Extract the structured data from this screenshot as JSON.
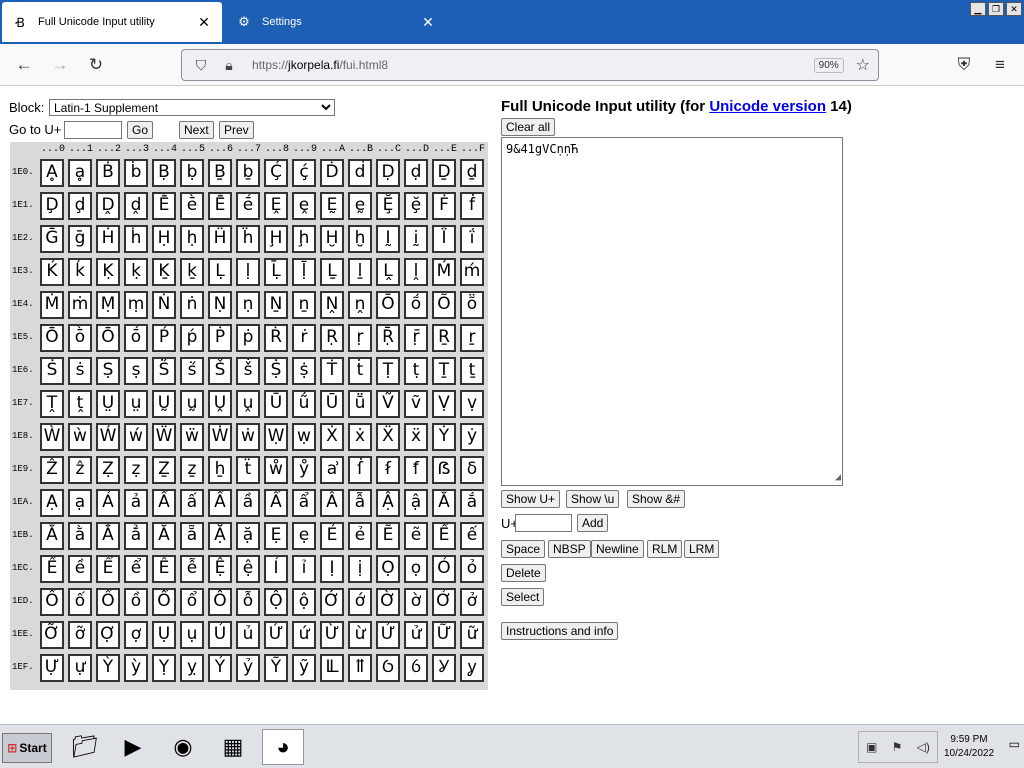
{
  "browser": {
    "tabs": [
      {
        "title": "Full Unicode Input utility",
        "icon": "unicode-favicon"
      },
      {
        "title": "Settings",
        "icon": "gear-icon"
      }
    ],
    "url_prefix": "https://",
    "url_host": "jkorpela.fi",
    "url_path": "/fui.html8",
    "zoom": "90%"
  },
  "page": {
    "block_label": "Block:",
    "block_selected": "Latin-1 Supplement",
    "goto_label": "Go to U+",
    "goto_value": "",
    "go_button": "Go",
    "next_button": "Next",
    "prev_button": "Prev",
    "title_prefix": "Full Unicode Input utility (for ",
    "title_link": "Unicode version",
    "title_suffix": " 14)",
    "clear_all": "Clear all",
    "textarea_value": "9&41gVϹṇṇЋ",
    "show_u_plus": "Show U+",
    "show_backslash_u": "Show \\u",
    "show_amp_hash": "Show &#",
    "uplus_label": "U+",
    "uplus_value": "",
    "add_button": "Add",
    "space_button": "Space",
    "nbsp_button": "NBSP",
    "newline_button": "Newline",
    "rlm_button": "RLM",
    "lrm_button": "LRM",
    "delete_button": "Delete",
    "select_button": "Select",
    "instructions_button": "Instructions and info"
  },
  "grid": {
    "column_headers": [
      "...0",
      "...1",
      "...2",
      "...3",
      "...4",
      "...5",
      "...6",
      "...7",
      "...8",
      "...9",
      "...A",
      "...B",
      "...C",
      "...D",
      "...E",
      "...F"
    ],
    "rows": [
      {
        "label": "1E0.",
        "chars": [
          "Ḁ",
          "ḁ",
          "Ḃ",
          "ḃ",
          "Ḅ",
          "ḅ",
          "Ḇ",
          "ḇ",
          "Ḉ",
          "ḉ",
          "Ḋ",
          "ḋ",
          "Ḍ",
          "ḍ",
          "Ḏ",
          "ḏ"
        ]
      },
      {
        "label": "1E1.",
        "chars": [
          "Ḑ",
          "ḑ",
          "Ḓ",
          "ḓ",
          "Ḕ",
          "ḕ",
          "Ḗ",
          "ḗ",
          "Ḙ",
          "ḙ",
          "Ḛ",
          "ḛ",
          "Ḝ",
          "ḝ",
          "Ḟ",
          "ḟ"
        ]
      },
      {
        "label": "1E2.",
        "chars": [
          "Ḡ",
          "ḡ",
          "Ḣ",
          "ḣ",
          "Ḥ",
          "ḥ",
          "Ḧ",
          "ḧ",
          "Ḩ",
          "ḩ",
          "Ḫ",
          "ḫ",
          "Ḭ",
          "ḭ",
          "Ḯ",
          "ḯ"
        ]
      },
      {
        "label": "1E3.",
        "chars": [
          "Ḱ",
          "ḱ",
          "Ḳ",
          "ḳ",
          "Ḵ",
          "ḵ",
          "Ḷ",
          "ḷ",
          "Ḹ",
          "ḹ",
          "Ḻ",
          "ḻ",
          "Ḽ",
          "ḽ",
          "Ḿ",
          "ḿ"
        ]
      },
      {
        "label": "1E4.",
        "chars": [
          "Ṁ",
          "ṁ",
          "Ṃ",
          "ṃ",
          "Ṅ",
          "ṅ",
          "Ṇ",
          "ṇ",
          "Ṉ",
          "ṉ",
          "Ṋ",
          "ṋ",
          "Ṍ",
          "ṍ",
          "Ṏ",
          "ṏ"
        ]
      },
      {
        "label": "1E5.",
        "chars": [
          "Ṑ",
          "ṑ",
          "Ṓ",
          "ṓ",
          "Ṕ",
          "ṕ",
          "Ṗ",
          "ṗ",
          "Ṙ",
          "ṙ",
          "Ṛ",
          "ṛ",
          "Ṝ",
          "ṝ",
          "Ṟ",
          "ṟ"
        ]
      },
      {
        "label": "1E6.",
        "chars": [
          "Ṡ",
          "ṡ",
          "Ṣ",
          "ṣ",
          "Ṥ",
          "ṥ",
          "Ṧ",
          "ṧ",
          "Ṩ",
          "ṩ",
          "Ṫ",
          "ṫ",
          "Ṭ",
          "ṭ",
          "Ṯ",
          "ṯ"
        ]
      },
      {
        "label": "1E7.",
        "chars": [
          "Ṱ",
          "ṱ",
          "Ṳ",
          "ṳ",
          "Ṵ",
          "ṵ",
          "Ṷ",
          "ṷ",
          "Ṹ",
          "ṹ",
          "Ṻ",
          "ṻ",
          "Ṽ",
          "ṽ",
          "Ṿ",
          "ṿ"
        ]
      },
      {
        "label": "1E8.",
        "chars": [
          "Ẁ",
          "ẁ",
          "Ẃ",
          "ẃ",
          "Ẅ",
          "ẅ",
          "Ẇ",
          "ẇ",
          "Ẉ",
          "ẉ",
          "Ẋ",
          "ẋ",
          "Ẍ",
          "ẍ",
          "Ẏ",
          "ẏ"
        ]
      },
      {
        "label": "1E9.",
        "chars": [
          "Ẑ",
          "ẑ",
          "Ẓ",
          "ẓ",
          "Ẕ",
          "ẕ",
          "ẖ",
          "ẗ",
          "ẘ",
          "ẙ",
          "ẚ",
          "ẛ",
          "ẜ",
          "ẝ",
          "ẞ",
          "ẟ"
        ]
      },
      {
        "label": "1EA.",
        "chars": [
          "Ạ",
          "ạ",
          "Ả",
          "ả",
          "Ấ",
          "ấ",
          "Ầ",
          "ầ",
          "Ẩ",
          "ẩ",
          "Ẫ",
          "ẫ",
          "Ậ",
          "ậ",
          "Ắ",
          "ắ"
        ]
      },
      {
        "label": "1EB.",
        "chars": [
          "Ằ",
          "ằ",
          "Ẳ",
          "ẳ",
          "Ẵ",
          "ẵ",
          "Ặ",
          "ặ",
          "Ẹ",
          "ẹ",
          "Ẻ",
          "ẻ",
          "Ẽ",
          "ẽ",
          "Ế",
          "ế"
        ]
      },
      {
        "label": "1EC.",
        "chars": [
          "Ề",
          "ề",
          "Ể",
          "ể",
          "Ễ",
          "ễ",
          "Ệ",
          "ệ",
          "Ỉ",
          "ỉ",
          "Ị",
          "ị",
          "Ọ",
          "ọ",
          "Ỏ",
          "ỏ"
        ]
      },
      {
        "label": "1ED.",
        "chars": [
          "Ố",
          "ố",
          "Ồ",
          "ồ",
          "Ổ",
          "ổ",
          "Ỗ",
          "ỗ",
          "Ộ",
          "ộ",
          "Ớ",
          "ớ",
          "Ờ",
          "ờ",
          "Ở",
          "ở"
        ]
      },
      {
        "label": "1EE.",
        "chars": [
          "Ỡ",
          "ỡ",
          "Ợ",
          "ợ",
          "Ụ",
          "ụ",
          "Ủ",
          "ủ",
          "Ứ",
          "ứ",
          "Ừ",
          "ừ",
          "Ử",
          "ử",
          "Ữ",
          "ữ"
        ]
      },
      {
        "label": "1EF.",
        "chars": [
          "Ự",
          "ự",
          "Ỳ",
          "ỳ",
          "Ỵ",
          "ỵ",
          "Ỷ",
          "ỷ",
          "Ỹ",
          "ỹ",
          "Ỻ",
          "ỻ",
          "Ỽ",
          "ỽ",
          "Ỿ",
          "ỿ"
        ]
      }
    ]
  },
  "taskbar": {
    "start_label": "Start",
    "apps": [
      "file-explorer-icon",
      "media-player-icon",
      "chrome-icon",
      "control-panel-icon",
      "firefox-icon"
    ],
    "time": "9:59 PM",
    "date": "10/24/2022"
  }
}
